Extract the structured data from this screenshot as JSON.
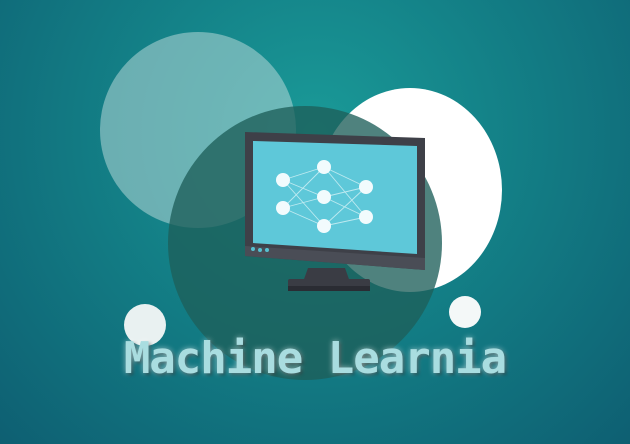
{
  "title": "Machine Learnia",
  "colors": {
    "background": "#137f86",
    "screen": "#5ec8d9",
    "frame": "#3e4048",
    "title_text": "#a9dde0"
  },
  "icons": [
    "neural-network-icon",
    "monitor-icon"
  ]
}
